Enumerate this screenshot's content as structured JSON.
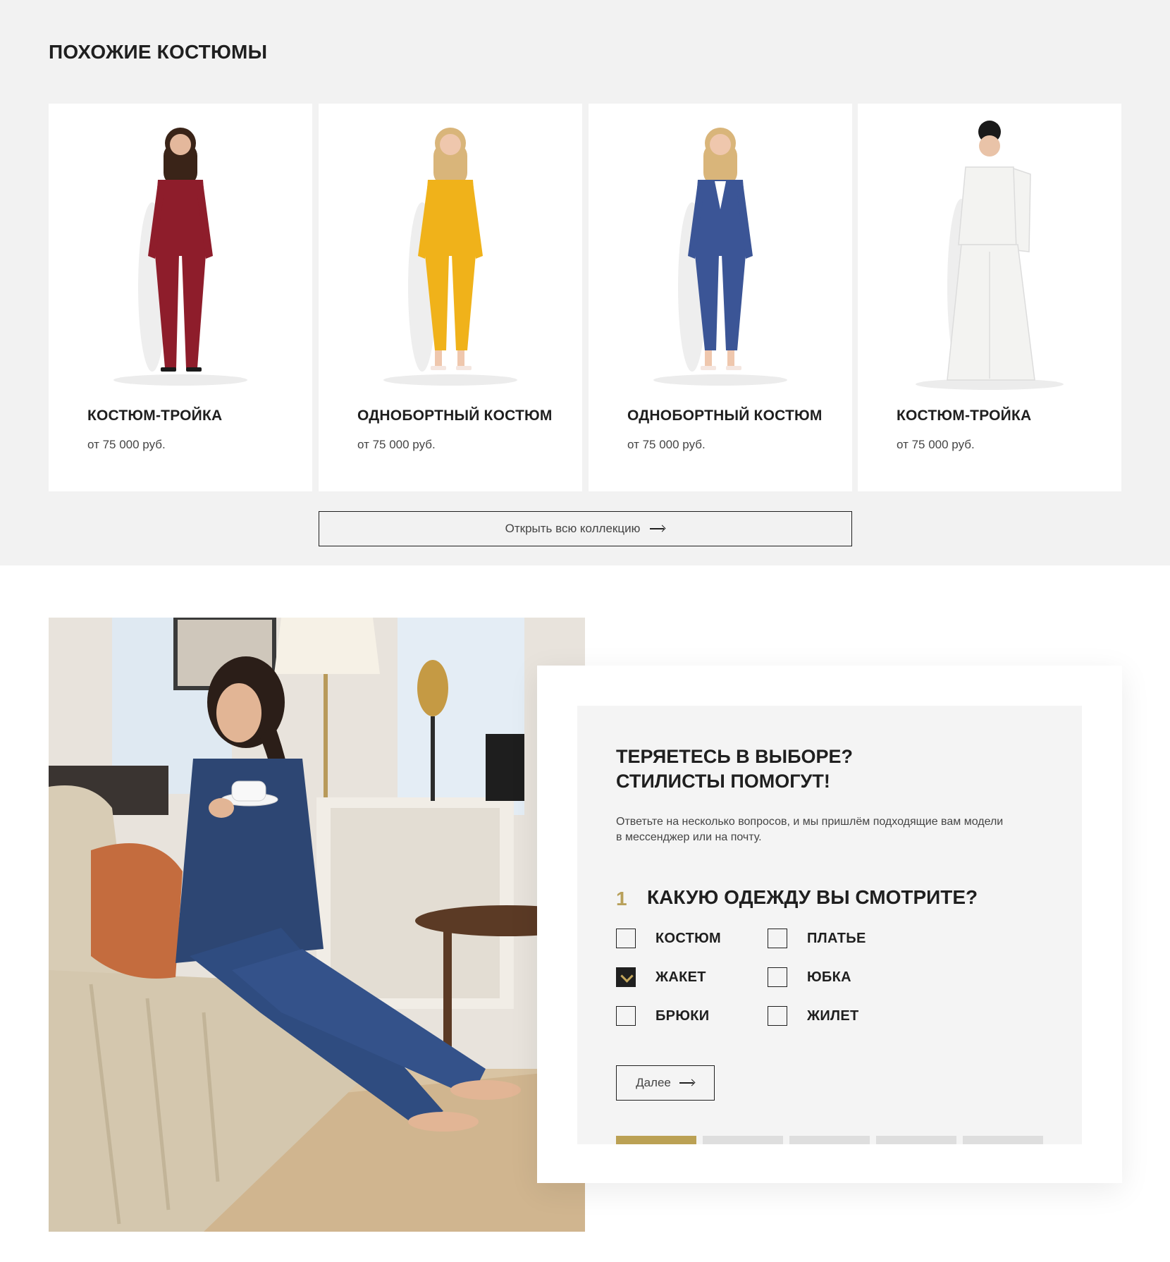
{
  "similar": {
    "title": "ПОХОЖИЕ КОСТЮМЫ",
    "products": [
      {
        "name": "КОСТЮМ-ТРОЙКА",
        "price": "от 75 000 руб.",
        "suit_color": "#8e1d2b",
        "hair_color": "#3a2418",
        "image": "model-burgundy-suit-photo"
      },
      {
        "name": "ОДНОБОРТНЫЙ КОСТЮМ",
        "price": "от 75 000 руб.",
        "suit_color": "#f0b21a",
        "hair_color": "#d9b57a",
        "image": "model-yellow-suit-photo"
      },
      {
        "name": "ОДНОБОРТНЫЙ КОСТЮМ",
        "price": "от 75 000 руб.",
        "suit_color": "#3b5596",
        "hair_color": "#d9b57a",
        "image": "model-blue-suit-photo"
      },
      {
        "name": "КОСТЮМ-ТРОЙКА",
        "price": "от 75 000 руб.",
        "suit_color": "#f3f3f1",
        "hair_color": "#1a1a1a",
        "image": "model-white-suit-photo"
      }
    ],
    "open_all_label": "Открыть всю коллекцию"
  },
  "quiz": {
    "image": "woman-in-blue-suit-with-coffee-photo",
    "title_line1": "ТЕРЯЕТЕСЬ В ВЫБОРЕ?",
    "title_line2": "СТИЛИСТЫ ПОМОГУТ!",
    "description": "Ответьте на несколько вопросов, и мы пришлём подходящие вам модели в мессенджер или на почту.",
    "question_number": "1",
    "question": "КАКУЮ ОДЕЖДУ ВЫ СМОТРИТЕ?",
    "options": [
      {
        "label": "КОСТЮМ",
        "checked": false
      },
      {
        "label": "ЖАКЕТ",
        "checked": true
      },
      {
        "label": "БРЮКИ",
        "checked": false
      },
      {
        "label": "ПЛАТЬЕ",
        "checked": false
      },
      {
        "label": "ЮБКА",
        "checked": false
      },
      {
        "label": "ЖИЛЕТ",
        "checked": false
      }
    ],
    "next_label": "Далее",
    "progress": {
      "current_step": 1,
      "total_steps": 5
    },
    "accent_color": "#bba154"
  }
}
